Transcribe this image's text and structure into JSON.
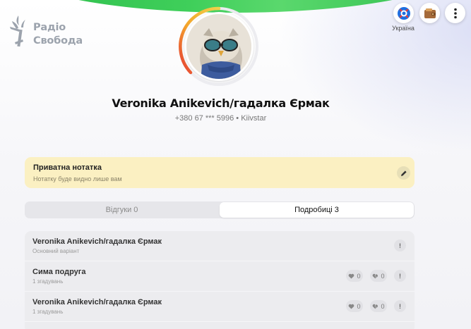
{
  "brand": {
    "line1": "Радіо",
    "line2": "Свобода"
  },
  "header": {
    "region_label": "Україна"
  },
  "profile": {
    "name": "Veronika Anikevich/гадалка Єрмак",
    "phone": "+380 67 *** 5996 • Kiivstar"
  },
  "note": {
    "title": "Приватна нотатка",
    "subtitle": "Нотатку буде видно лише вам"
  },
  "tabs": [
    {
      "label": "Відгуки 0",
      "active": false
    },
    {
      "label": "Подробиці 3",
      "active": true
    }
  ],
  "details": [
    {
      "title": "Veronika Anikevich/гадалка Єрмак",
      "subtitle": "Основний варіант"
    },
    {
      "title": "Сима подруга",
      "subtitle": "1 згадувань",
      "likes": "0",
      "dislikes": "0"
    },
    {
      "title": "Veronika Anikevich/гадалка Єрмак",
      "subtitle": "1 згадувань",
      "likes": "0",
      "dislikes": "0"
    }
  ],
  "colors": {
    "accent_green": "#2dbd4c",
    "note_bg": "#fbf0c2"
  }
}
